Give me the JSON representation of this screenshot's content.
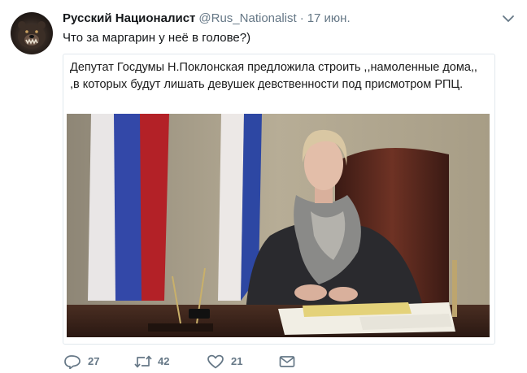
{
  "tweet": {
    "display_name": "Русский Националист",
    "handle": "@Rus_Nationalist",
    "separator": "·",
    "time": "17 июн.",
    "text": "Что за маргарин у неё в голове?)"
  },
  "card": {
    "caption": "Депутат Госдумы Н.Поклонская предложила строить ,,намоленные дома,, ,в которых будут лишать девушек девственности  под присмотром РПЦ."
  },
  "actions": {
    "reply_count": "27",
    "retweet_count": "42",
    "like_count": "21"
  },
  "icons": {
    "avatar": "bear-avatar",
    "menu": "chevron-down-icon",
    "reply": "reply-icon",
    "retweet": "retweet-icon",
    "like": "heart-icon",
    "dm": "envelope-icon"
  },
  "colors": {
    "text": "#14171a",
    "secondary": "#657786",
    "border": "#e1e8ed"
  }
}
